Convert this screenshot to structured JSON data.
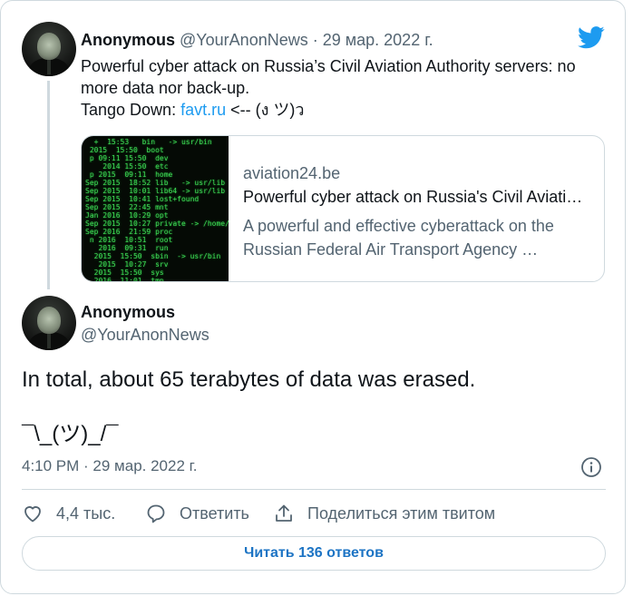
{
  "parent_tweet": {
    "author_name": "Anonymous",
    "author_handle": "@YourAnonNews",
    "date": "29 мар. 2022 г.",
    "separator": " · ",
    "text_line1": "Powerful cyber attack on Russia’s Civil Aviation Authority servers: no",
    "text_line2": "more data nor back-up.",
    "text_line3_prefix": "Tango Down: ",
    "text_link": "favt.ru",
    "text_line3_suffix": " <-- (ง ツ)ว",
    "card": {
      "domain": "aviation24.be",
      "title": "Powerful cyber attack on Russia's Civil Aviati…",
      "description": "A powerful and effective cyberattack on the Russian Federal Air Transport Agency …"
    }
  },
  "main_tweet": {
    "author_name": "Anonymous",
    "author_handle": "@YourAnonNews",
    "text": "In total, about 65 terabytes of data was erased.",
    "shrug": "¯\\_(ツ)_/¯",
    "time": "4:10 PM · 29 мар. 2022 г."
  },
  "actions": {
    "like_count": "4,4 тыс.",
    "reply_label": "Ответить",
    "share_label": "Поделиться этим твитом"
  },
  "replies_button": "Читать 136 ответов",
  "colors": {
    "accent": "#1d9bf0",
    "secondary_text": "#536471",
    "border": "#cfd9de"
  },
  "icons": [
    "twitter-bird-icon",
    "info-icon",
    "heart-icon",
    "reply-bubble-icon",
    "share-icon"
  ]
}
